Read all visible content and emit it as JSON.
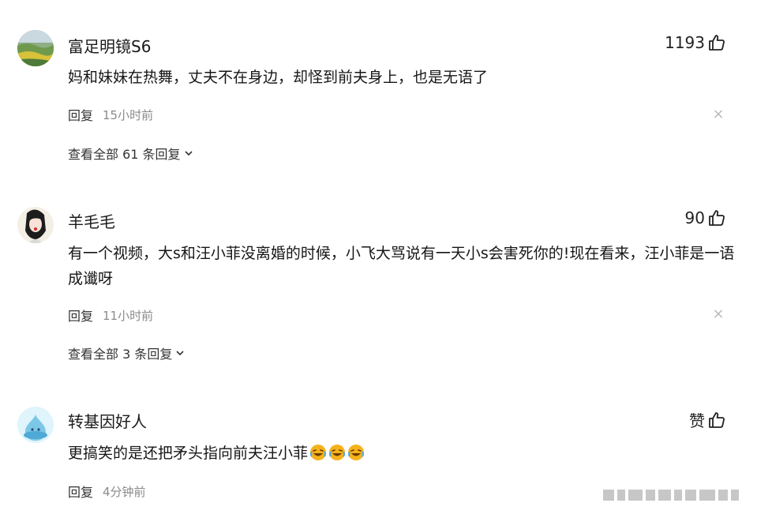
{
  "comments": [
    {
      "username": "富足明镜S6",
      "likes": "1193",
      "content": "妈和妹妹在热舞，丈夫不在身边，却怪到前夫身上，也是无语了",
      "reply_label": "回复",
      "time": "15小时前",
      "view_replies": "查看全部 61 条回复"
    },
    {
      "username": "羊毛毛",
      "likes": "90",
      "content": "有一个视频，大s和汪小菲没离婚的时候，小飞大骂说有一天小s会害死你的!现在看来，汪小菲是一语成谶呀",
      "reply_label": "回复",
      "time": "11小时前",
      "view_replies": "查看全部 3 条回复"
    },
    {
      "username": "转基因好人",
      "likes": "赞",
      "content": "更搞笑的是还把矛头指向前夫汪小菲",
      "reply_label": "回复",
      "time": "4分钟前"
    }
  ],
  "icons": {
    "like": "thumb-up-icon",
    "close": "close-icon",
    "expand": "chevron-down-icon",
    "emoji": "laughing-crying-emoji"
  },
  "colors": {
    "text": "#161616",
    "meta": "#8a8a8a",
    "close": "#b9b9b9",
    "emoji": "#f5b21b"
  }
}
